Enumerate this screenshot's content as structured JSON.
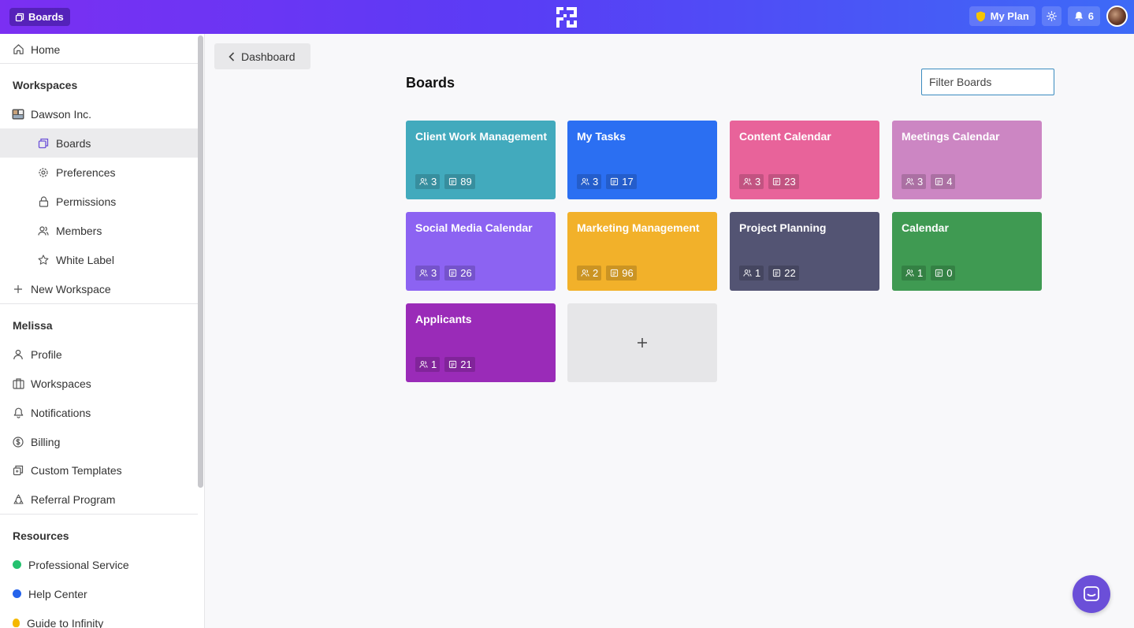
{
  "topbar": {
    "boards_label": "Boards",
    "plan_label": "My Plan",
    "notification_count": "6"
  },
  "sidebar": {
    "home": "Home",
    "workspaces_heading": "Workspaces",
    "workspace_name": "Dawson Inc.",
    "workspace_items": [
      {
        "label": "Boards",
        "icon": "boards-icon",
        "active": true
      },
      {
        "label": "Preferences",
        "icon": "gear-icon"
      },
      {
        "label": "Permissions",
        "icon": "lock-icon"
      },
      {
        "label": "Members",
        "icon": "members-icon"
      },
      {
        "label": "White Label",
        "icon": "star-icon"
      }
    ],
    "new_workspace": "New Workspace",
    "user_heading": "Melissa",
    "user_items": [
      {
        "label": "Profile",
        "icon": "user-icon"
      },
      {
        "label": "Workspaces",
        "icon": "building-icon"
      },
      {
        "label": "Notifications",
        "icon": "bell-icon"
      },
      {
        "label": "Billing",
        "icon": "dollar-icon"
      },
      {
        "label": "Custom Templates",
        "icon": "templates-icon"
      },
      {
        "label": "Referral Program",
        "icon": "referral-icon"
      }
    ],
    "resources_heading": "Resources",
    "resource_items": [
      {
        "label": "Professional Service",
        "icon": "whatsapp-icon",
        "color": "#25c16f"
      },
      {
        "label": "Help Center",
        "icon": "help-icon",
        "color": "#2563eb"
      },
      {
        "label": "Guide to Infinity",
        "icon": "bulb-icon",
        "color": "#f5b800"
      }
    ]
  },
  "main": {
    "back_label": "Dashboard",
    "title": "Boards",
    "filter_placeholder": "Filter Boards",
    "boards": [
      {
        "name": "Client Work Management",
        "members": "3",
        "items": "89",
        "color": "#42aabd"
      },
      {
        "name": "My Tasks",
        "members": "3",
        "items": "17",
        "color": "#2b6ff2"
      },
      {
        "name": "Content Calendar",
        "members": "3",
        "items": "23",
        "color": "#e8639a"
      },
      {
        "name": "Meetings Calendar",
        "members": "3",
        "items": "4",
        "color": "#cc86c3"
      },
      {
        "name": "Social Media Calendar",
        "members": "3",
        "items": "26",
        "color": "#8c63f2"
      },
      {
        "name": "Marketing Management",
        "members": "2",
        "items": "96",
        "color": "#f2b12a"
      },
      {
        "name": "Project Planning",
        "members": "1",
        "items": "22",
        "color": "#535473"
      },
      {
        "name": "Calendar",
        "members": "1",
        "items": "0",
        "color": "#3f9a52"
      },
      {
        "name": "Applicants",
        "members": "1",
        "items": "21",
        "color": "#9a2bb8"
      }
    ]
  }
}
